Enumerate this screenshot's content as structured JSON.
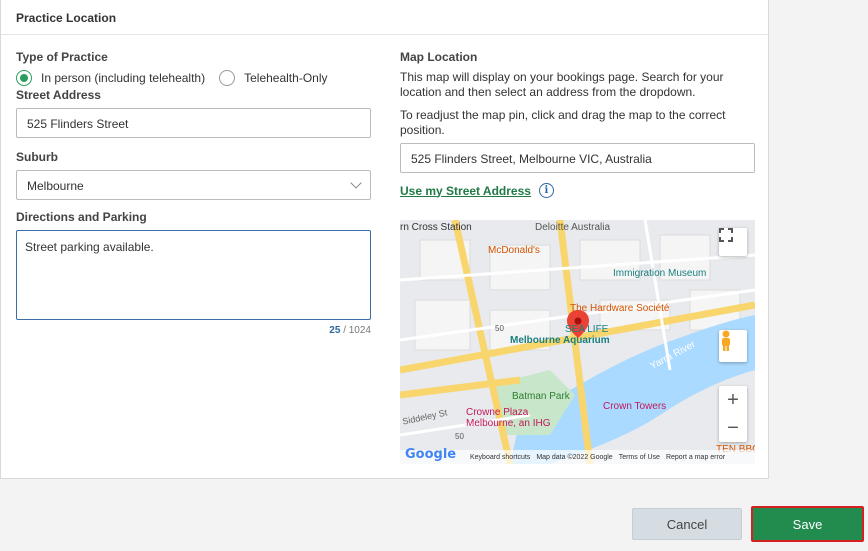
{
  "panel": {
    "title": "Practice Location"
  },
  "left": {
    "type_label": "Type of Practice",
    "options": [
      {
        "label": "In person (including telehealth)",
        "checked": true
      },
      {
        "label": "Telehealth-Only",
        "checked": false
      }
    ],
    "street_label": "Street Address",
    "street_value": "525 Flinders Street",
    "suburb_label": "Suburb",
    "suburb_value": "Melbourne",
    "directions_label": "Directions and Parking",
    "directions_value": "Street parking available.",
    "counter_current": "25",
    "counter_max": "/ 1024"
  },
  "right": {
    "map_label": "Map Location",
    "desc1": "This map will display on your bookings page. Search for your location and then select an address from the dropdown.",
    "desc2": "To readjust the map pin, click and drag the map to the correct position.",
    "search_value": "525 Flinders Street, Melbourne VIC, Australia",
    "use_address_link": "Use my Street Address"
  },
  "map": {
    "labels": {
      "cross_station": "rn Cross Station",
      "deloitte": "Deloitte Australia",
      "mcdonalds": "McDonald's",
      "immigration": "Immigration Museum",
      "hardware": "The Hardware Société",
      "sea_life": "SEA LIFE",
      "aquarium": "Melbourne Aquarium",
      "yarra": "Yarra River",
      "batman": "Batman Park",
      "crowne1": "Crowne Plaza",
      "crowne2": "Melbourne, an IHG",
      "crown_towers": "Crown Towers",
      "siddeley": "Siddeley St",
      "ten_bbq": "TEN BBQ",
      "route50a": "50",
      "route50b": "50"
    },
    "google": "Google",
    "footer": [
      "Keyboard shortcuts",
      "Map data ©2022 Google",
      "Terms of Use",
      "Report a map error"
    ]
  },
  "actions": {
    "cancel": "Cancel",
    "save": "Save"
  }
}
